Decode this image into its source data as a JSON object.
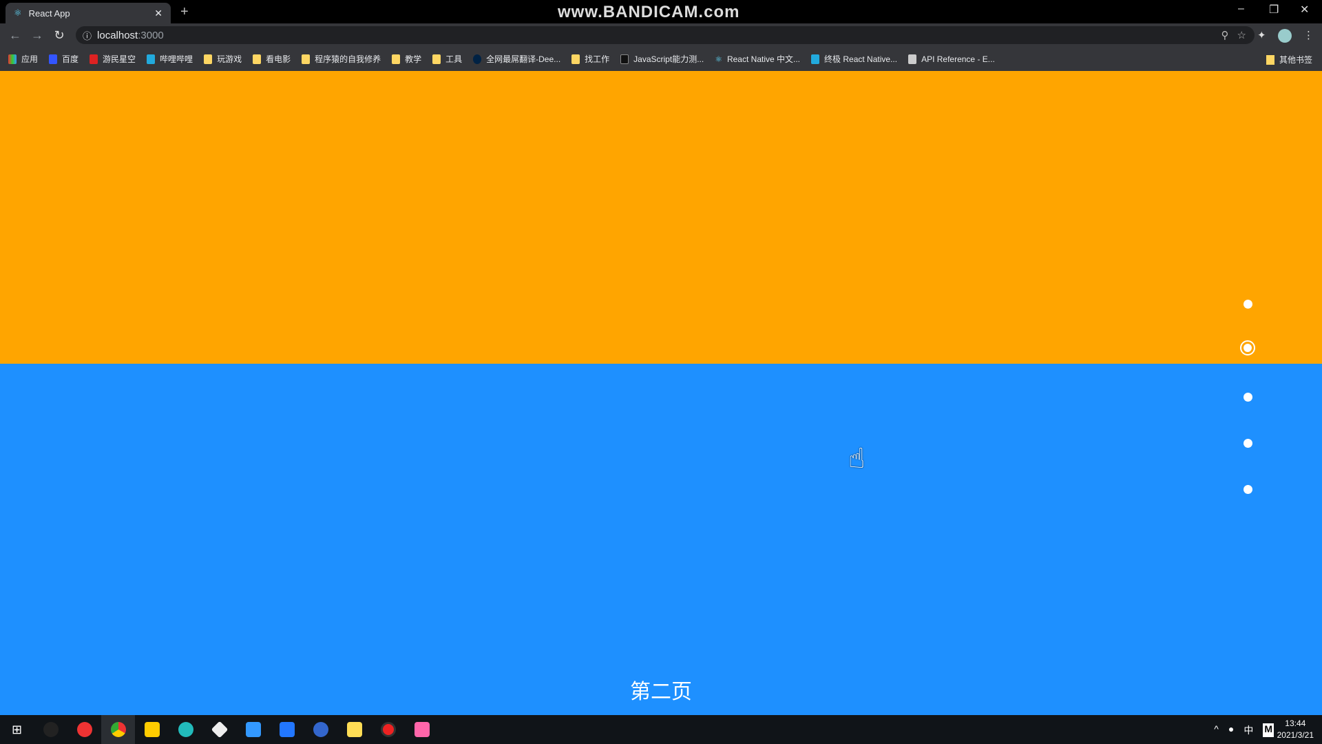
{
  "browser": {
    "tab_title": "React App",
    "url_host": "localhost",
    "url_port": ":3000",
    "watermark": "www.BANDICAM.com"
  },
  "bookmarks": [
    "应用",
    "百度",
    "游民星空",
    "哔哩哔哩",
    "玩游戏",
    "看电影",
    "程序猿的自我修养",
    "教学",
    "工具",
    "全网最屌翻译-Dee...",
    "找工作",
    "JavaScript能力测...",
    "React Native 中文...",
    "终极 React Native...",
    "API Reference - E..."
  ],
  "other_bookmarks": "其他书签",
  "page": {
    "section_title": "第二页",
    "colors": {
      "section1": "#FFA500",
      "section2": "#1E90FF"
    },
    "dots_count": 5,
    "active_dot": 2
  },
  "tray": {
    "input_method": "中",
    "time": "13:44",
    "date": "2021/3/21"
  },
  "taskbar_colors": [
    "#e33",
    "#ddd",
    "#fc0",
    "#2bb",
    "#eee",
    "#39f",
    "#27f",
    "#36c",
    "#fd5",
    "#e22",
    "#f6a"
  ]
}
